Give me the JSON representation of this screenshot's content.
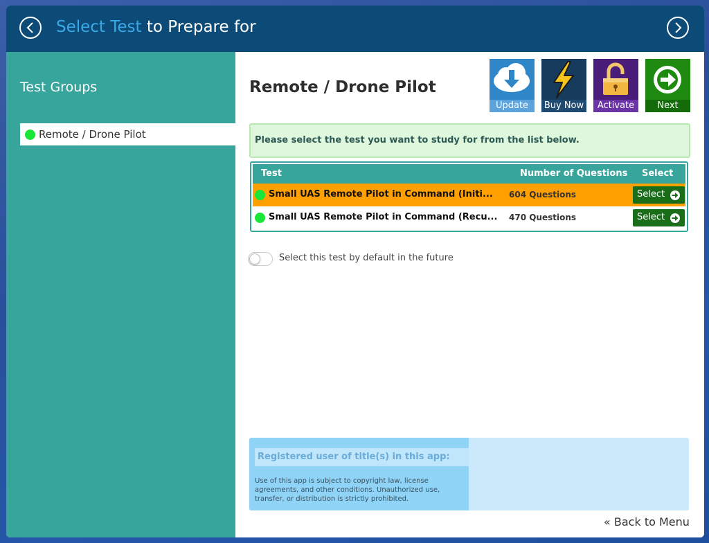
{
  "header": {
    "title_highlight": "Select Test",
    "title_rest": " to Prepare for",
    "back_icon": "chevron-left-circle-icon",
    "forward_icon": "chevron-right-circle-icon"
  },
  "sidebar": {
    "heading": "Test Groups",
    "items": [
      {
        "label": "Remote / Drone Pilot",
        "status_color": "#19e639"
      }
    ]
  },
  "main": {
    "group_title": "Remote / Drone Pilot",
    "toolbar": {
      "update_label": "Update",
      "buynow_label": "Buy Now",
      "activate_label": "Activate",
      "next_label": "Next"
    },
    "notice": "Please select the test you want to study for from the list below.",
    "table": {
      "headers": {
        "test": "Test",
        "questions": "Number of Questions",
        "select": "Select"
      },
      "rows": [
        {
          "name": "Small UAS Remote Pilot in Command (Initi...",
          "questions": "604 Questions",
          "select_label": "Select",
          "highlighted": true
        },
        {
          "name": "Small UAS Remote Pilot in Command (Recu...",
          "questions": "470 Questions",
          "select_label": "Select",
          "highlighted": false
        }
      ]
    },
    "default_toggle_label": "Select this test by default in the future",
    "registered": {
      "heading": "Registered user of title(s) in this app:",
      "legal": "Use of this app is subject to copyright law, license agreements, and other conditions. Unauthorized use, transfer, or distribution is strictly prohibited."
    },
    "back_to_menu": "Back to Menu"
  },
  "colors": {
    "titlebar": "#0c4a77",
    "accent": "#3aa9e8",
    "sidebar": "#38a59c",
    "highlight_row": "#ff9f00",
    "select_button": "#1a6e1a"
  }
}
